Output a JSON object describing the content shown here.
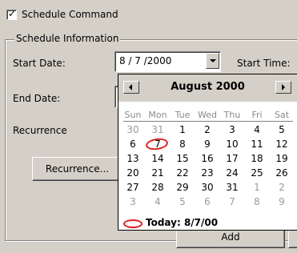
{
  "schedule_command": {
    "label": "Schedule Command",
    "checked": true
  },
  "group": {
    "title": "Schedule Information",
    "start_date_label": "Start Date:",
    "start_date_value": "8 / 7 /2000",
    "start_time_label": "Start Time:",
    "end_date_label": "End Date:",
    "recurrence_label": "Recurrence",
    "recurrence_button": "Recurrence...",
    "add_button": "Add"
  },
  "calendar": {
    "title": "August 2000",
    "days_of_week": [
      "Sun",
      "Mon",
      "Tue",
      "Wed",
      "Thu",
      "Fri",
      "Sat"
    ],
    "weeks": [
      [
        "30",
        "31",
        "1",
        "2",
        "3",
        "4",
        "5"
      ],
      [
        "6",
        "7",
        "8",
        "9",
        "10",
        "11",
        "12"
      ],
      [
        "13",
        "14",
        "15",
        "16",
        "17",
        "18",
        "19"
      ],
      [
        "20",
        "21",
        "22",
        "23",
        "24",
        "25",
        "26"
      ],
      [
        "27",
        "28",
        "29",
        "30",
        "31",
        "1",
        "2"
      ],
      [
        "3",
        "4",
        "5",
        "6",
        "7",
        "8",
        "9"
      ]
    ],
    "selected_day": "7",
    "today_label": "Today: 8/7/00"
  },
  "colors": {
    "face": "#d4d0c8",
    "accent": "#e02020"
  }
}
